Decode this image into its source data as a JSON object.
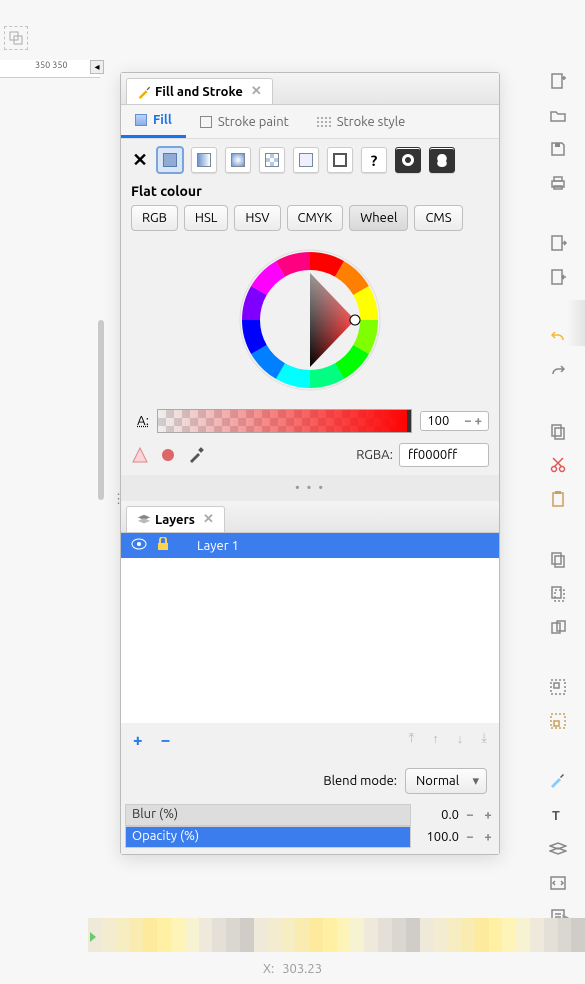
{
  "ruler": {
    "mark": "350"
  },
  "panels": {
    "fill": {
      "title": "Fill and Stroke",
      "tabs": {
        "fill": "Fill",
        "stroke_paint": "Stroke paint",
        "stroke_style": "Stroke style"
      },
      "mode_label": "Flat colour",
      "color_modes": [
        "RGB",
        "HSL",
        "HSV",
        "CMYK",
        "Wheel",
        "CMS"
      ],
      "color_mode_selected": "Wheel",
      "alpha_label": "A:",
      "alpha_value": "100",
      "rgba_label": "RGBA:",
      "rgba_value": "ff0000ff"
    },
    "layers": {
      "title": "Layers",
      "items": [
        {
          "name": "Layer 1",
          "visible": true,
          "locked": false
        }
      ],
      "blend_label": "Blend mode:",
      "blend_value": "Normal",
      "blur_label": "Blur (%)",
      "blur_value": "0.0",
      "opacity_label": "Opacity (%)",
      "opacity_value": "100.0"
    }
  },
  "status": {
    "x_label": "X:",
    "x_value": "303.23"
  },
  "colors": {
    "accent": "#3b7ded"
  }
}
